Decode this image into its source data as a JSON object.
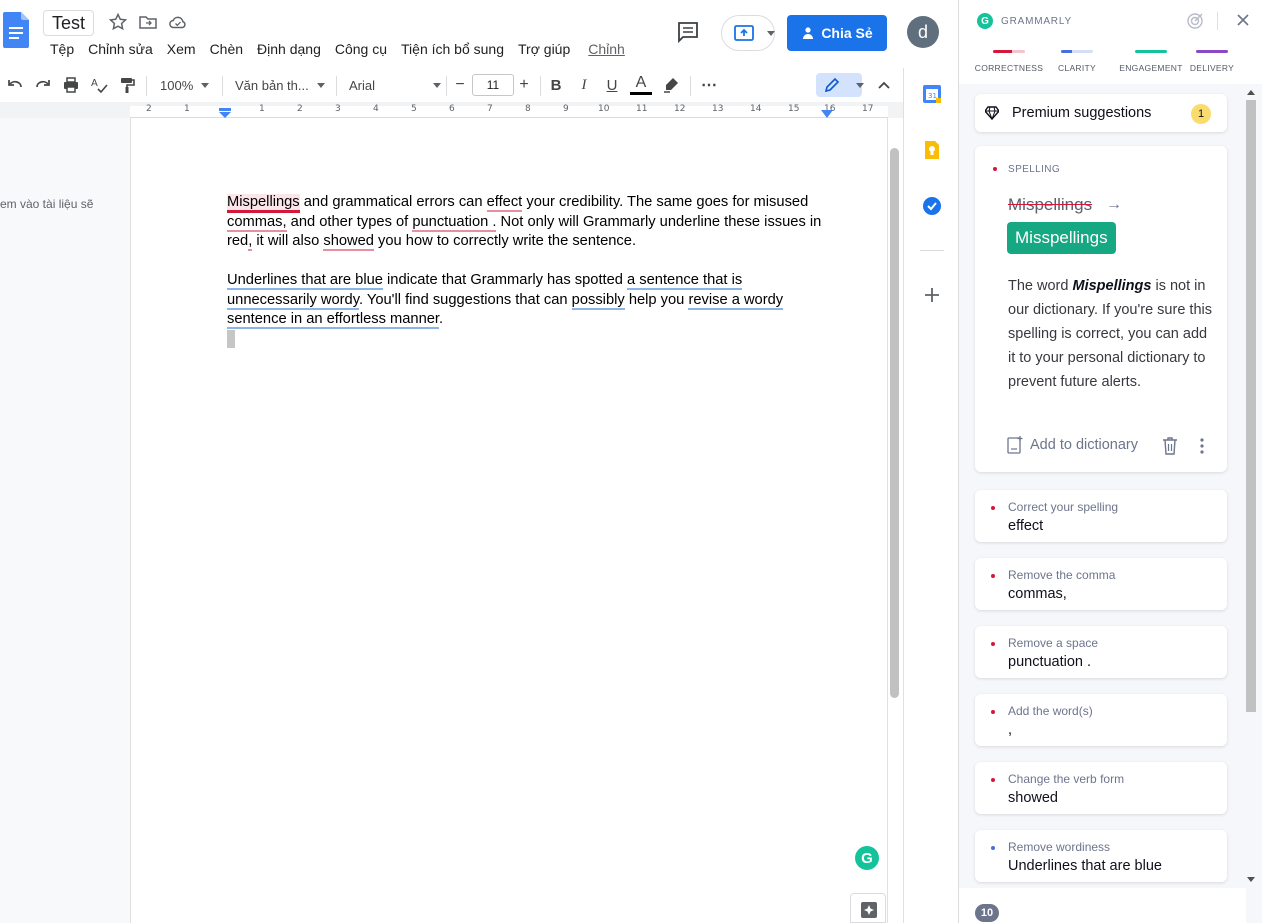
{
  "docs": {
    "title": "Test",
    "menu": [
      "Tệp",
      "Chỉnh sửa",
      "Xem",
      "Chèn",
      "Định dạng",
      "Công cụ",
      "Tiện ích bổ sung",
      "Trợ giúp"
    ],
    "last_edit_link": "Chỉnh",
    "share_label": "Chia Sẻ",
    "avatar_letter": "d",
    "outline_text": "em vào tài liệu sẽ"
  },
  "toolbar": {
    "zoom": "100%",
    "style": "Văn bản th...",
    "font": "Arial",
    "font_size": "11",
    "minus": "−",
    "plus": "+",
    "bold": "B",
    "italic": "I",
    "underline": "U",
    "text_color": "A",
    "more": "⋯"
  },
  "ruler": {
    "labels": [
      "2",
      "1",
      "1",
      "2",
      "3",
      "4",
      "5",
      "6",
      "7",
      "8",
      "9",
      "10",
      "11",
      "12",
      "13",
      "14",
      "15",
      "16",
      "17"
    ]
  },
  "document": {
    "p1": {
      "w1": "Mispellings",
      "t1": " and grammatical errors can ",
      "w2": "effect",
      "t2": " your credibility. The same goes for misused ",
      "w3": "commas,",
      "t3": " and other types of ",
      "w4": "punctuation .",
      "t4": " Not only will Grammarly underline these issues in red",
      "w5": ",",
      "t5": " it will also ",
      "w6": "showed",
      "t6": " you how to correctly write the sentence."
    },
    "p2": {
      "w1": "Underlines that are blue",
      "t1": " indicate that Grammarly has spotted ",
      "w2": "a sentence that is unnecessarily wordy",
      "t2": ". You'll find suggestions that can ",
      "w3": "possibly",
      "t3": " help you ",
      "w4": "revise a wordy sentence in an effortless manner",
      "t4": "."
    }
  },
  "grammarly": {
    "brand": "GRAMMARLY",
    "categories": [
      {
        "label": "CORRECTNESS",
        "color": "#d2193c"
      },
      {
        "label": "CLARITY",
        "color": "#4a6ee0"
      },
      {
        "label": "ENGAGEMENT",
        "color": "#15c39a"
      },
      {
        "label": "DELIVERY",
        "color": "#8a47c6"
      }
    ],
    "premium": {
      "label": "Premium suggestions",
      "count": "1"
    },
    "spelling_card": {
      "label": "SPELLING",
      "original": "Mispellings",
      "arrow": "→",
      "replacement": "Misspellings",
      "explanation_prefix": "The word ",
      "explanation_word": "Mispellings",
      "explanation_suffix": " is not in our dictionary. If you're sure this spelling is correct, you can add it to your personal dictionary to prevent future alerts.",
      "add_to_dictionary": "Add to dictionary"
    },
    "suggestions": [
      {
        "title": "Correct your spelling",
        "value": "effect",
        "color": "#d2193c"
      },
      {
        "title": "Remove the comma",
        "value": "commas,",
        "color": "#d2193c"
      },
      {
        "title": "Remove a space",
        "value": "punctuation .",
        "color": "#d2193c"
      },
      {
        "title": "Add the word(s)",
        "value": ",",
        "color": "#d2193c"
      },
      {
        "title": "Change the verb form",
        "value": "showed",
        "color": "#d2193c"
      },
      {
        "title": "Remove wordiness",
        "value": "Underlines that are blue",
        "color": "#4a6ee0"
      }
    ],
    "total_count": "10"
  }
}
